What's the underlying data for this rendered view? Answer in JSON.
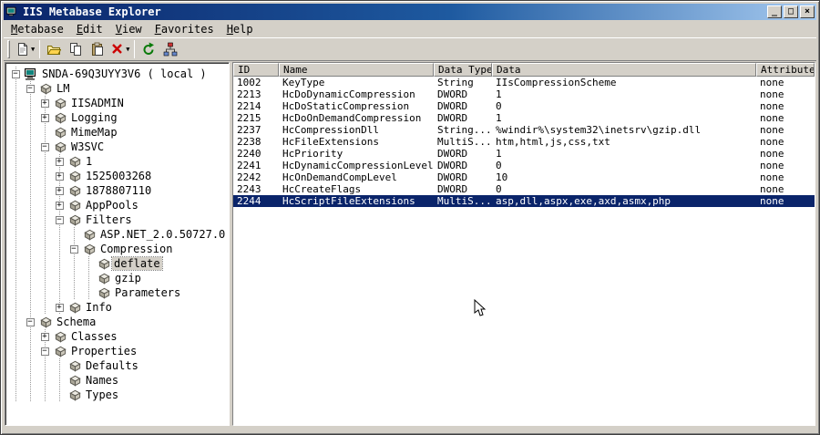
{
  "window": {
    "title": "IIS Metabase Explorer",
    "controls": [
      {
        "name": "minimize-button",
        "glyph": "_"
      },
      {
        "name": "maximize-button",
        "glyph": "□"
      },
      {
        "name": "close-button",
        "glyph": "×"
      }
    ]
  },
  "menu": {
    "items": [
      {
        "label": "Metabase"
      },
      {
        "label": "Edit"
      },
      {
        "label": "View"
      },
      {
        "label": "Favorites"
      },
      {
        "label": "Help"
      }
    ]
  },
  "toolbar": {
    "buttons": [
      {
        "name": "new-record-button",
        "icon": "new",
        "dropdown": true
      },
      {
        "type": "separator"
      },
      {
        "name": "open-button",
        "icon": "open"
      },
      {
        "name": "copy-button",
        "icon": "copy"
      },
      {
        "name": "paste-button",
        "icon": "paste"
      },
      {
        "name": "delete-button",
        "icon": "delete",
        "dropdown": true
      },
      {
        "type": "separator"
      },
      {
        "name": "refresh-button",
        "icon": "refresh"
      },
      {
        "name": "connect-button",
        "icon": "connect"
      }
    ]
  },
  "tree": {
    "nodes": [
      {
        "label": "SNDA-69Q3UYY3V6 ( local )",
        "level": 0,
        "expander": "minus",
        "icon": "computer",
        "selected": false
      },
      {
        "label": "LM",
        "level": 1,
        "expander": "minus",
        "icon": "db",
        "selected": false
      },
      {
        "label": "IISADMIN",
        "level": 2,
        "expander": "plus",
        "icon": "db",
        "selected": false
      },
      {
        "label": "Logging",
        "level": 2,
        "expander": "plus",
        "icon": "db",
        "selected": false
      },
      {
        "label": "MimeMap",
        "level": 2,
        "expander": "none",
        "icon": "db",
        "selected": false
      },
      {
        "label": "W3SVC",
        "level": 2,
        "expander": "minus",
        "icon": "db",
        "selected": false
      },
      {
        "label": "1",
        "level": 3,
        "expander": "plus",
        "icon": "db",
        "selected": false
      },
      {
        "label": "1525003268",
        "level": 3,
        "expander": "plus",
        "icon": "db",
        "selected": false
      },
      {
        "label": "1878807110",
        "level": 3,
        "expander": "plus",
        "icon": "db",
        "selected": false
      },
      {
        "label": "AppPools",
        "level": 3,
        "expander": "plus",
        "icon": "db",
        "selected": false
      },
      {
        "label": "Filters",
        "level": 3,
        "expander": "minus",
        "icon": "db",
        "selected": false
      },
      {
        "label": "ASP.NET_2.0.50727.0",
        "level": 4,
        "expander": "none",
        "icon": "db",
        "selected": false
      },
      {
        "label": "Compression",
        "level": 4,
        "expander": "minus",
        "icon": "db",
        "selected": false
      },
      {
        "label": "deflate",
        "level": 5,
        "expander": "none",
        "icon": "db",
        "selected": true
      },
      {
        "label": "gzip",
        "level": 5,
        "expander": "none",
        "icon": "db",
        "selected": false
      },
      {
        "label": "Parameters",
        "level": 5,
        "expander": "none",
        "icon": "db",
        "selected": false
      },
      {
        "label": "Info",
        "level": 3,
        "expander": "plus",
        "icon": "db",
        "selected": false
      },
      {
        "label": "Schema",
        "level": 1,
        "expander": "minus",
        "icon": "db",
        "selected": false
      },
      {
        "label": "Classes",
        "level": 2,
        "expander": "plus",
        "icon": "db",
        "selected": false
      },
      {
        "label": "Properties",
        "level": 2,
        "expander": "minus",
        "icon": "db",
        "selected": false
      },
      {
        "label": "Defaults",
        "level": 3,
        "expander": "none",
        "icon": "db",
        "selected": false
      },
      {
        "label": "Names",
        "level": 3,
        "expander": "none",
        "icon": "db",
        "selected": false
      },
      {
        "label": "Types",
        "level": 3,
        "expander": "none",
        "icon": "db",
        "selected": false
      }
    ]
  },
  "table": {
    "columns": [
      "ID",
      "Name",
      "Data Type",
      "Data",
      "Attributes"
    ],
    "rows": [
      [
        "1002",
        "KeyType",
        "String",
        "IIsCompressionScheme",
        "none"
      ],
      [
        "2213",
        "HcDoDynamicCompression",
        "DWORD",
        "1",
        "none"
      ],
      [
        "2214",
        "HcDoStaticCompression",
        "DWORD",
        "0",
        "none"
      ],
      [
        "2215",
        "HcDoOnDemandCompression",
        "DWORD",
        "1",
        "none"
      ],
      [
        "2237",
        "HcCompressionDll",
        "String...",
        "%windir%\\system32\\inetsrv\\gzip.dll",
        "none"
      ],
      [
        "2238",
        "HcFileExtensions",
        "MultiS...",
        "htm,html,js,css,txt",
        "none"
      ],
      [
        "2240",
        "HcPriority",
        "DWORD",
        "1",
        "none"
      ],
      [
        "2241",
        "HcDynamicCompressionLevel",
        "DWORD",
        "0",
        "none"
      ],
      [
        "2242",
        "HcOnDemandCompLevel",
        "DWORD",
        "10",
        "none"
      ],
      [
        "2243",
        "HcCreateFlags",
        "DWORD",
        "0",
        "none"
      ],
      [
        "2244",
        "HcScriptFileExtensions",
        "MultiS...",
        "asp,dll,aspx,exe,axd,asmx,php",
        "none"
      ]
    ],
    "selected_id": "2244"
  }
}
